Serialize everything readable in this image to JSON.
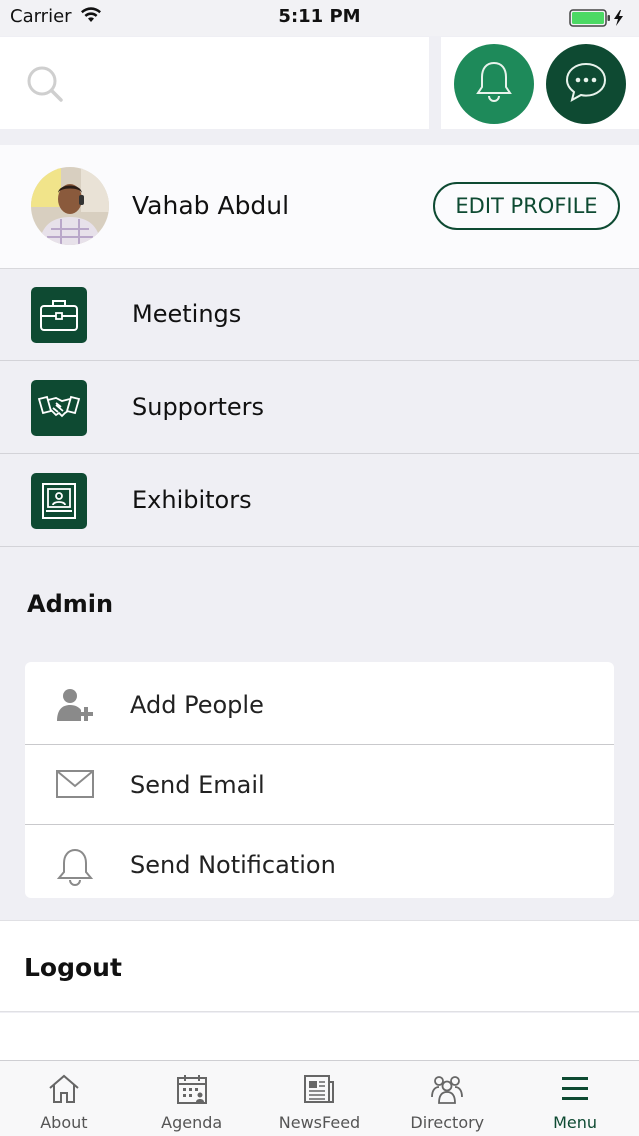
{
  "status_bar": {
    "carrier": "Carrier",
    "time": "5:11 PM",
    "icons": [
      "wifi-icon",
      "battery-icon",
      "charging-bolt-icon"
    ]
  },
  "search": {
    "placeholder": "",
    "value": "",
    "icon": "search-icon"
  },
  "header_actions": {
    "notifications_icon": "bell-icon",
    "messages_icon": "chat-bubble-icon"
  },
  "profile": {
    "name": "Vahab Abdul",
    "edit_label": "EDIT PROFILE"
  },
  "menu": {
    "items": [
      {
        "label": "Meetings",
        "icon": "briefcase-icon"
      },
      {
        "label": "Supporters",
        "icon": "handshake-icon"
      },
      {
        "label": "Exhibitors",
        "icon": "booth-icon"
      }
    ]
  },
  "admin": {
    "title": "Admin",
    "items": [
      {
        "label": "Add People",
        "icon": "add-person-icon"
      },
      {
        "label": "Send Email",
        "icon": "envelope-icon"
      },
      {
        "label": "Send Notification",
        "icon": "bell-icon"
      }
    ]
  },
  "logout": {
    "label": "Logout"
  },
  "tabbar": {
    "active": "Menu",
    "tabs": [
      {
        "label": "About",
        "icon": "home-icon"
      },
      {
        "label": "Agenda",
        "icon": "calendar-icon"
      },
      {
        "label": "NewsFeed",
        "icon": "newspaper-icon"
      },
      {
        "label": "Directory",
        "icon": "people-icon"
      },
      {
        "label": "Menu",
        "icon": "hamburger-icon"
      }
    ]
  },
  "colors": {
    "brand_dark": "#0e4a32",
    "brand_light": "#1e8a5a",
    "background": "#efeff4"
  }
}
